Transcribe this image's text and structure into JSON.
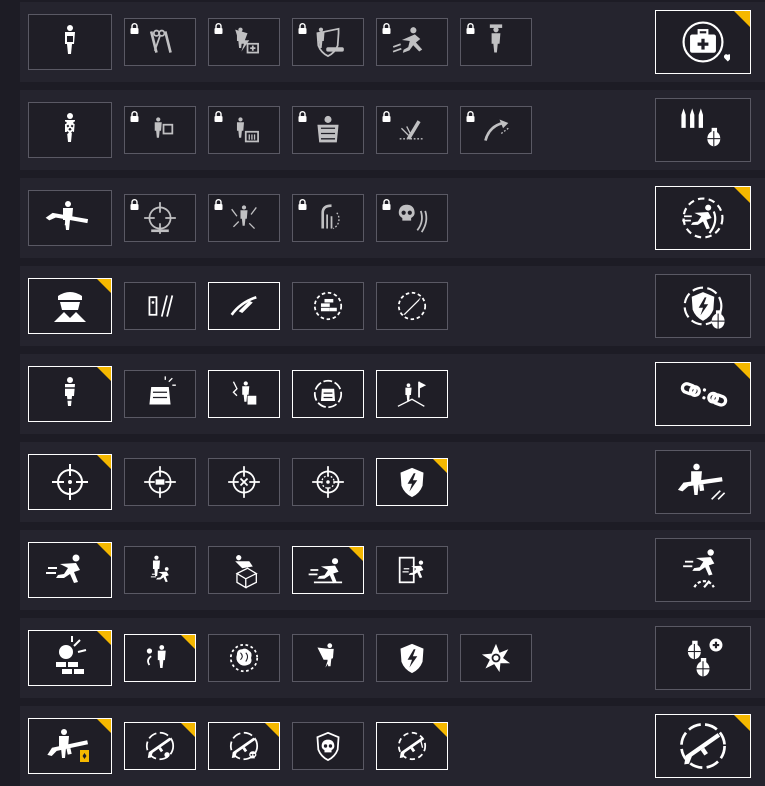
{
  "colors": {
    "background": "#1d1c25",
    "row": "#25242e",
    "tile": "#1f1e26",
    "border_inactive": "#5a5964",
    "border_active": "#ffffff",
    "badge": "#f5b800",
    "icon": "#ffffff"
  },
  "trees": [
    {
      "base": {
        "icon": "medic-doctor-icon",
        "active": false
      },
      "skills": [
        {
          "icon": "medical-tools-icon",
          "locked": true,
          "active": false,
          "badge": false
        },
        {
          "icon": "medic-revive-kit-icon",
          "locked": true,
          "active": false,
          "badge": false
        },
        {
          "icon": "revive-downed-ally-icon",
          "locked": true,
          "active": false,
          "badge": false
        },
        {
          "icon": "drag-ally-icon",
          "locked": true,
          "active": false,
          "badge": false
        },
        {
          "icon": "officer-suit-icon",
          "locked": true,
          "active": false,
          "badge": false
        }
      ],
      "perk": {
        "icon": "medkit-shield-icon",
        "active": true,
        "badge": true
      }
    },
    {
      "base": {
        "icon": "ammo-carrier-icon",
        "active": false
      },
      "skills": [
        {
          "icon": "supply-toss-icon",
          "locked": true,
          "active": false,
          "badge": false
        },
        {
          "icon": "resupply-crate-icon",
          "locked": true,
          "active": false,
          "badge": false
        },
        {
          "icon": "heavy-armor-icon",
          "locked": true,
          "active": false,
          "badge": false
        },
        {
          "icon": "bullet-impact-icon",
          "locked": true,
          "active": false,
          "badge": false
        },
        {
          "icon": "grenade-throw-icon",
          "locked": true,
          "active": false,
          "badge": false
        }
      ],
      "perk": {
        "icon": "ammo-grenade-icon",
        "active": false,
        "badge": false
      }
    },
    {
      "base": {
        "icon": "rifleman-icon",
        "active": false
      },
      "skills": [
        {
          "icon": "crosshair-target-icon",
          "locked": true,
          "active": false,
          "badge": false
        },
        {
          "icon": "suppressed-soldier-icon",
          "locked": true,
          "active": false,
          "badge": false
        },
        {
          "icon": "quick-reload-icon",
          "locked": true,
          "active": false,
          "badge": false
        },
        {
          "icon": "skull-reload-icon",
          "locked": true,
          "active": false,
          "badge": false
        }
      ],
      "perk": {
        "icon": "sprint-reload-icon",
        "active": true,
        "badge": true
      }
    },
    {
      "base": {
        "icon": "bandit-mask-icon",
        "active": true,
        "badge": true
      },
      "skills": [
        {
          "icon": "lockpick-tools-icon",
          "locked": false,
          "active": false,
          "badge": false
        },
        {
          "icon": "knife-slash-icon",
          "locked": false,
          "active": true,
          "badge": false
        },
        {
          "icon": "coin-stack-icon",
          "locked": false,
          "active": false,
          "badge": false
        },
        {
          "icon": "blade-circle-icon",
          "locked": false,
          "active": false,
          "badge": false
        }
      ],
      "perk": {
        "icon": "shield-grenade-icon",
        "active": false,
        "badge": false
      }
    },
    {
      "base": {
        "icon": "armored-vest-icon",
        "active": true,
        "badge": true
      },
      "skills": [
        {
          "icon": "vest-burst-icon",
          "locked": false,
          "active": false,
          "badge": false
        },
        {
          "icon": "crate-carry-icon",
          "locked": false,
          "active": true,
          "badge": false
        },
        {
          "icon": "vest-refresh-icon",
          "locked": false,
          "active": true,
          "badge": false
        },
        {
          "icon": "climb-flag-icon",
          "locked": false,
          "active": true,
          "badge": false
        }
      ],
      "perk": {
        "icon": "broken-chain-icon",
        "active": true,
        "badge": true
      }
    },
    {
      "base": {
        "icon": "scope-crosshair-icon",
        "active": true,
        "badge": true
      },
      "skills": [
        {
          "icon": "crosshair-battery-icon",
          "locked": false,
          "active": false,
          "badge": false
        },
        {
          "icon": "crosshair-sparkle-icon",
          "locked": false,
          "active": false,
          "badge": false
        },
        {
          "icon": "crosshair-dot-icon",
          "locked": false,
          "active": false,
          "badge": false
        },
        {
          "icon": "shield-lightning-icon",
          "locked": false,
          "active": true,
          "badge": true
        }
      ],
      "perk": {
        "icon": "sniper-aim-icon",
        "active": false,
        "badge": false
      }
    },
    {
      "base": {
        "icon": "sprint-icon",
        "active": true,
        "badge": true
      },
      "skills": [
        {
          "icon": "carry-ally-icon",
          "locked": false,
          "active": false,
          "badge": false
        },
        {
          "icon": "vault-box-icon",
          "locked": false,
          "active": false,
          "badge": false
        },
        {
          "icon": "slide-icon",
          "locked": false,
          "active": true,
          "badge": true
        },
        {
          "icon": "door-breach-icon",
          "locked": false,
          "active": false,
          "badge": false
        }
      ],
      "perk": {
        "icon": "dash-gauge-icon",
        "active": false,
        "badge": false
      }
    },
    {
      "base": {
        "icon": "wall-explosion-icon",
        "active": true,
        "badge": true
      },
      "skills": [
        {
          "icon": "grenadier-icon",
          "locked": false,
          "active": true,
          "badge": true
        },
        {
          "icon": "brain-shock-icon",
          "locked": false,
          "active": false,
          "badge": false
        },
        {
          "icon": "electric-soldier-icon",
          "locked": false,
          "active": false,
          "badge": false
        },
        {
          "icon": "shield-bolt-icon",
          "locked": false,
          "active": false,
          "badge": false
        },
        {
          "icon": "explosion-burst-icon",
          "locked": false,
          "active": false,
          "badge": false
        }
      ],
      "perk": {
        "icon": "grenade-plus-icon",
        "active": false,
        "badge": false
      }
    },
    {
      "base": {
        "icon": "shotgunner-card-icon",
        "active": true,
        "badge": true
      },
      "skills": [
        {
          "icon": "rifle-reload-icon",
          "locked": false,
          "active": true,
          "badge": true
        },
        {
          "icon": "rifle-skull-icon",
          "locked": false,
          "active": true,
          "badge": true
        },
        {
          "icon": "skull-shield-icon",
          "locked": false,
          "active": false,
          "badge": false
        },
        {
          "icon": "rifle-cycle-icon",
          "locked": false,
          "active": true,
          "badge": true
        }
      ],
      "perk": {
        "icon": "rifle-circle-icon",
        "active": true,
        "badge": true
      }
    }
  ]
}
